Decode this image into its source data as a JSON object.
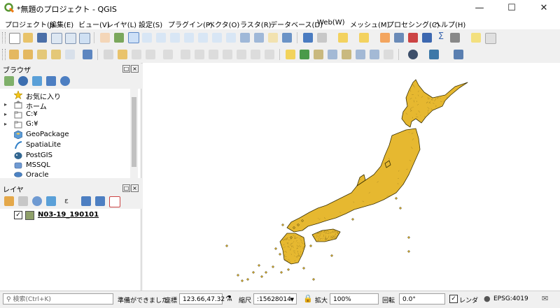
{
  "window": {
    "title": "*無題のプロジェクト - QGIS"
  },
  "menu": [
    "プロジェクト(J)",
    "編集(E)",
    "ビュー(V)",
    "レイヤ(L)",
    "設定(S)",
    "プラグイン(P)",
    "ベクタ(O)",
    "ラスタ(R)",
    "データベース(D)",
    "Web(W)",
    "メッシュ(M)",
    "プロセシング(C)",
    "ヘルプ(H)"
  ],
  "browser": {
    "title": "ブラウザ",
    "items": [
      {
        "label": "お気に入り",
        "icon": "star-icon"
      },
      {
        "label": "ホーム",
        "icon": "home-folder-icon"
      },
      {
        "label": "C:¥",
        "icon": "folder-icon"
      },
      {
        "label": "G:¥",
        "icon": "folder-icon"
      },
      {
        "label": "GeoPackage",
        "icon": "geopackage-icon"
      },
      {
        "label": "SpatiaLite",
        "icon": "spatialite-icon"
      },
      {
        "label": "PostGIS",
        "icon": "postgis-icon"
      },
      {
        "label": "MSSQL",
        "icon": "mssql-icon"
      },
      {
        "label": "Oracle",
        "icon": "oracle-icon"
      }
    ]
  },
  "layers": {
    "title": "レイヤ",
    "items": [
      {
        "name": "N03-19_190101",
        "checked": true,
        "color": "#8fa06a"
      }
    ]
  },
  "map": {
    "fill": "#e6b830",
    "stroke": "#3a3000"
  },
  "status": {
    "search_placeholder": "検索(Ctrl+K)",
    "ready": "準備ができました",
    "coord_label": "座標",
    "coord_value": "123.66,47.32",
    "scale_label": "縮尺",
    "scale_value": ":15628014",
    "magnify_label": "拡大",
    "magnify_value": "100%",
    "rotation_label": "回転",
    "rotation_value": "0.0°",
    "render_label": "レンダ",
    "crs": "EPSG:4019"
  }
}
